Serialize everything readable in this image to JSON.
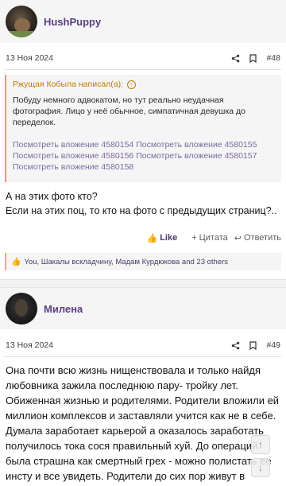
{
  "post1": {
    "username": "HushPuppy",
    "date": "13 Ноя 2024",
    "number": "#48",
    "quote": {
      "author_line": "Ржущая Кобыла написал(а):",
      "text": "Побуду немного адвокатом, но тут реально неудачная фотография. Лицо у неё обычное, симпатичная девушка до переделок.",
      "attachments": [
        "Посмотреть вложение 4580154",
        "Посмотреть вложение 4580155",
        "Посмотреть вложение 4580156",
        "Посмотреть вложение 4580157",
        "Посмотреть вложение 4580158"
      ]
    },
    "body_line1": "А на этих фото кто?",
    "body_line2": "Если на этих поц, то кто на фото с предыдущих страниц?..",
    "actions": {
      "like": "Like",
      "quote": "Цитата",
      "reply": "Ответить"
    },
    "reactions": "You, Шакалы вскладчину, Мадам Курдюкова and 23 others"
  },
  "post2": {
    "username": "Милена",
    "date": "13 Ноя 2024",
    "number": "#49",
    "body": "Она почти всю жизнь нищенствовала и только найдя любовника зажила последнюю пару- тройку лет. Обиженная жизнью и родителями. Родители вложили ей миллион комплексов и заставляли учится как не в себе. Думала заработает карьерой а оказалось заработать получилось тока сося правильный хуй. До операций была страшна как смертный грех - можно полистать ее инсту и все увидеть. Родители до сих пор живут в бедноте и в совдеповском ремонте"
  },
  "icons": {
    "share": "share-icon",
    "bookmark": "bookmark-icon",
    "like": "thumbs-up-icon",
    "scroll_up": "arrow-up-icon",
    "scroll_down": "arrow-down-icon"
  },
  "colors": {
    "username": "#5b3e84",
    "quote_accent": "#e9a62f",
    "attach_link": "#7a6aa0"
  }
}
